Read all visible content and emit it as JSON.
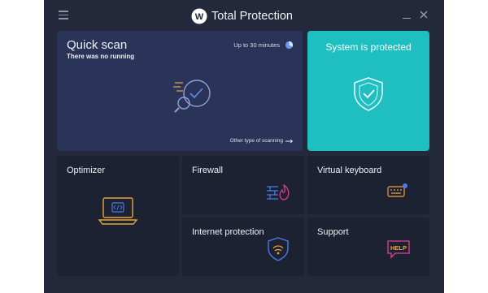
{
  "window": {
    "title": "Total Protection",
    "brand_logo": "W"
  },
  "icons": {
    "menu": "hamburger-menu-icon",
    "minimize": "minimize-icon",
    "close": "close-icon",
    "clock": "clock-icon",
    "scan": "scan-magnifier-icon",
    "shield": "shield-check-icon",
    "laptop": "laptop-code-icon",
    "firewall": "firewall-icon",
    "keyboard": "keyboard-icon",
    "internet": "internet-shield-icon",
    "support": "help-bubble-icon",
    "arrow": "arrow-right-icon"
  },
  "colors": {
    "window_bg": "#23283a",
    "tile_bg": "#1d2233",
    "quick_scan_bg": "#2a3459",
    "protected_bg": "#1ebec1",
    "accent_blue": "#4a7be8",
    "accent_orange": "#e9a23b",
    "accent_pink": "#e0418f"
  },
  "quick_scan": {
    "title": "Quick scan",
    "subtitle": "There was no running",
    "duration": "Up to 30 minutes",
    "other_link": "Other type of scanning"
  },
  "status": {
    "label": "System is protected"
  },
  "tiles": {
    "optimizer": "Optimizer",
    "firewall": "Firewall",
    "virtual_keyboard": "Virtual keyboard",
    "internet_protection": "Internet protection",
    "support": "Support",
    "help_badge": "HELP"
  }
}
